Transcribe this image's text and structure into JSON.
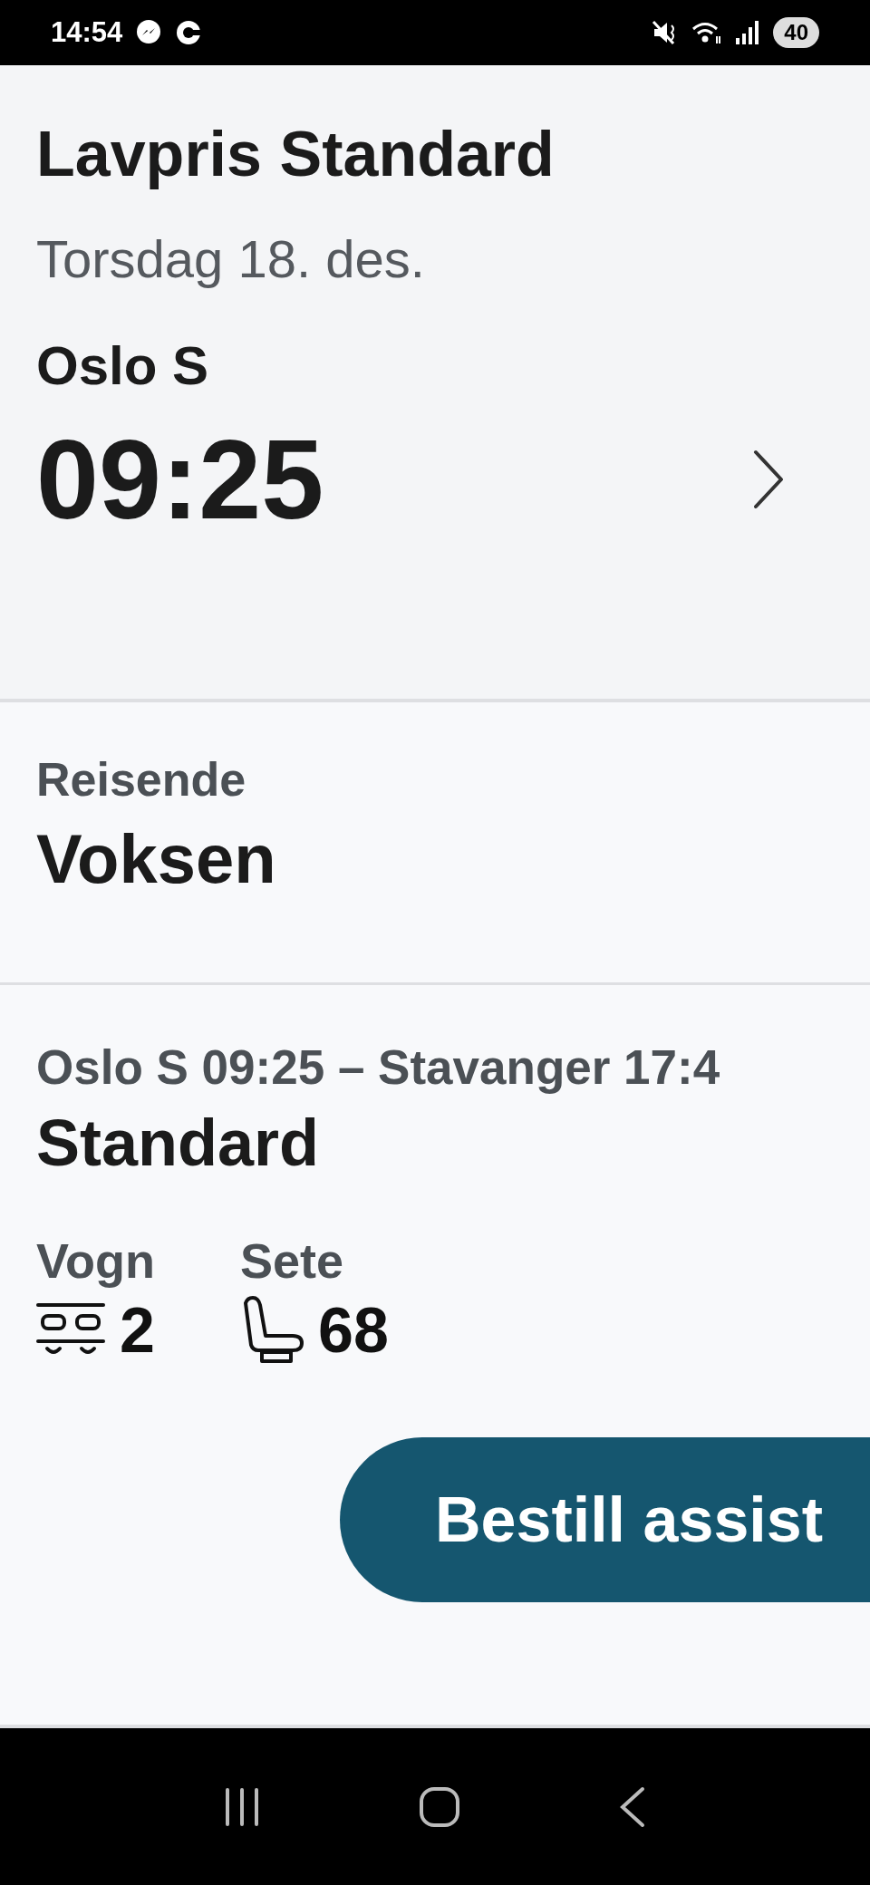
{
  "status_bar": {
    "time": "14:54",
    "battery": "40"
  },
  "ticket": {
    "title": "Lavpris Standard",
    "date": "Torsdag 18. des.",
    "station": "Oslo S",
    "departure_time": "09:25"
  },
  "traveller": {
    "label": "Reisende",
    "value": "Voksen"
  },
  "seat_section": {
    "route": "Oslo S 09:25 – Stavanger 17:4",
    "class": "Standard",
    "details": [
      {
        "kind": "wagon",
        "label": "Vogn",
        "value": "2"
      },
      {
        "kind": "seat",
        "label": "Sete",
        "value": "68"
      }
    ],
    "button": "Bestill assist"
  }
}
